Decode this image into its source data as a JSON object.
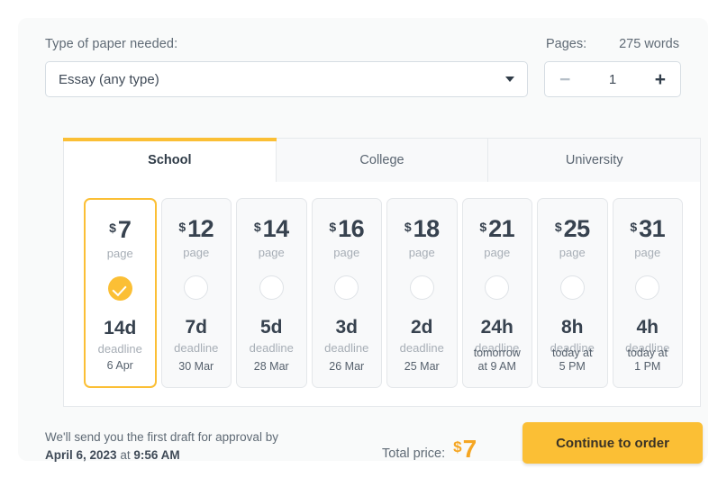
{
  "form": {
    "paper_type_label": "Type of paper needed:",
    "paper_type_value": "Essay (any type)",
    "pages_label": "Pages:",
    "words_label": "275 words",
    "pages_value": "1",
    "minus_label": "−",
    "plus_label": "+"
  },
  "tabs": [
    {
      "label": "School",
      "active": true
    },
    {
      "label": "College",
      "active": false
    },
    {
      "label": "University",
      "active": false
    }
  ],
  "cards": [
    {
      "currency": "$",
      "price": "7",
      "per": "page",
      "deadline": "14d",
      "deadline_label": "deadline",
      "date": "6 Apr",
      "selected": true
    },
    {
      "currency": "$",
      "price": "12",
      "per": "page",
      "deadline": "7d",
      "deadline_label": "deadline",
      "date": "30 Mar",
      "selected": false
    },
    {
      "currency": "$",
      "price": "14",
      "per": "page",
      "deadline": "5d",
      "deadline_label": "deadline",
      "date": "28 Mar",
      "selected": false
    },
    {
      "currency": "$",
      "price": "16",
      "per": "page",
      "deadline": "3d",
      "deadline_label": "deadline",
      "date": "26 Mar",
      "selected": false
    },
    {
      "currency": "$",
      "price": "18",
      "per": "page",
      "deadline": "2d",
      "deadline_label": "deadline",
      "date": "25 Mar",
      "selected": false
    },
    {
      "currency": "$",
      "price": "21",
      "per": "page",
      "deadline": "24h",
      "deadline_label": "deadline",
      "date": "tomorrow\nat 9 AM",
      "selected": false
    },
    {
      "currency": "$",
      "price": "25",
      "per": "page",
      "deadline": "8h",
      "deadline_label": "deadline",
      "date": "today at\n5 PM",
      "selected": false
    },
    {
      "currency": "$",
      "price": "31",
      "per": "page",
      "deadline": "4h",
      "deadline_label": "deadline",
      "date": "today at\n1 PM",
      "selected": false
    }
  ],
  "footer": {
    "draft_line1": "We'll send you the first draft for approval by",
    "draft_date": "April 6, 2023",
    "draft_at": "at",
    "draft_time": "9:56 AM",
    "total_label": "Total price:",
    "total_currency": "$",
    "total_value": "7",
    "cta_label": "Continue to order"
  },
  "colors": {
    "accent": "#fbbf35",
    "price_accent": "#f5a623",
    "panel_bg": "#f9fafa",
    "text_dark": "#37424f",
    "text_muted": "#a7aeb6"
  }
}
